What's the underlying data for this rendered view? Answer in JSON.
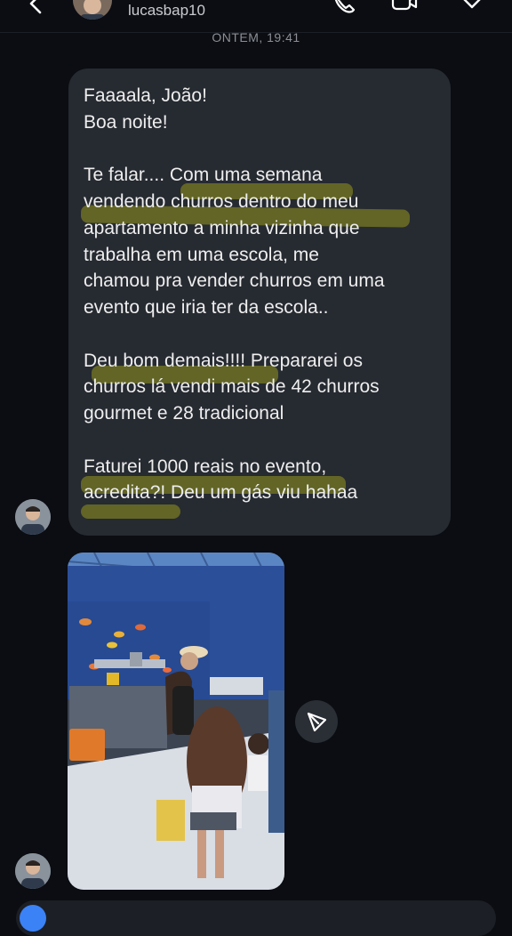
{
  "header": {
    "username": "lucasbap10",
    "icons": [
      "back-arrow-icon",
      "call-icon",
      "video-icon",
      "heart-icon"
    ]
  },
  "conversation": {
    "timestamp": "ONTEM, 19:41",
    "message": {
      "lines": [
        "Faaaala, João!",
        "Boa noite!",
        "",
        "Te falar.... Com uma semana",
        "vendendo churros dentro do meu",
        "apartamento a minha vizinha  que",
        "trabalha em uma escola, me",
        "chamou pra vender churros em uma",
        "evento que iria ter da escola..",
        "",
        "Deu bom demais!!!!  Prepararei os",
        "churros lá vendi mais de 42 churros",
        "gourmet e 28 tradicional",
        "",
        "Faturei 1000 reais no evento,",
        "acredita?! Deu um gás viu hahaa"
      ]
    },
    "media": {
      "type": "photo",
      "share_icon": "send-icon"
    }
  },
  "colors": {
    "background": "#0b0d12",
    "bubble": "#262a31",
    "highlight": "#93961c",
    "text": "#eeeeee",
    "timestamp": "#8c8f96"
  }
}
